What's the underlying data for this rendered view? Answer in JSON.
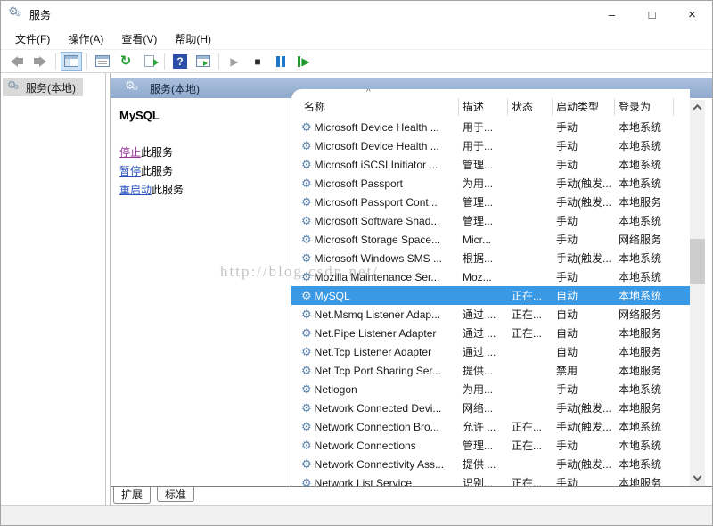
{
  "window": {
    "title": "服务",
    "controls": {
      "minimize": "–",
      "maximize": "□",
      "close": "×"
    }
  },
  "menu": {
    "items": [
      "文件(F)",
      "操作(A)",
      "查看(V)",
      "帮助(H)"
    ]
  },
  "toolbar": {
    "help_glyph": "?",
    "refresh_glyph": "↻",
    "start_glyph": "▶",
    "stop_glyph": "■",
    "restart_glyph": "▶",
    "icons": [
      "back-icon",
      "forward-icon",
      "show-console-tree-icon",
      "properties-icon",
      "refresh-icon",
      "export-list-icon",
      "help-icon",
      "show-action-pane-icon",
      "start-service-icon",
      "stop-service-icon",
      "pause-service-icon",
      "restart-service-icon"
    ]
  },
  "tree": {
    "root_label": "服务(本地)"
  },
  "main": {
    "header_label": "服务(本地)",
    "detail": {
      "service_name": "MySQL",
      "links": [
        {
          "action": "停止",
          "suffix": "此服务",
          "visited": true
        },
        {
          "action": "暂停",
          "suffix": "此服务"
        },
        {
          "action": "重启动",
          "suffix": "此服务"
        }
      ]
    },
    "list": {
      "sort_indicator": "^",
      "columns": [
        "名称",
        "描述",
        "状态",
        "启动类型",
        "登录为"
      ],
      "rows": [
        {
          "name": "Microsoft Device Health ...",
          "desc": "用于...",
          "status": "",
          "startup": "手动",
          "logon": "本地系统"
        },
        {
          "name": "Microsoft Device Health ...",
          "desc": "用于...",
          "status": "",
          "startup": "手动",
          "logon": "本地系统"
        },
        {
          "name": "Microsoft iSCSI Initiator ...",
          "desc": "管理...",
          "status": "",
          "startup": "手动",
          "logon": "本地系统"
        },
        {
          "name": "Microsoft Passport",
          "desc": "为用...",
          "status": "",
          "startup": "手动(触发...",
          "logon": "本地系统"
        },
        {
          "name": "Microsoft Passport Cont...",
          "desc": "管理...",
          "status": "",
          "startup": "手动(触发...",
          "logon": "本地服务"
        },
        {
          "name": "Microsoft Software Shad...",
          "desc": "管理...",
          "status": "",
          "startup": "手动",
          "logon": "本地系统"
        },
        {
          "name": "Microsoft Storage Space...",
          "desc": "Micr...",
          "status": "",
          "startup": "手动",
          "logon": "网络服务"
        },
        {
          "name": "Microsoft Windows SMS ...",
          "desc": "根据...",
          "status": "",
          "startup": "手动(触发...",
          "logon": "本地系统"
        },
        {
          "name": "Mozilla Maintenance Ser...",
          "desc": "Moz...",
          "status": "",
          "startup": "手动",
          "logon": "本地系统"
        },
        {
          "name": "MySQL",
          "desc": "",
          "status": "正在...",
          "startup": "自动",
          "logon": "本地系统",
          "selected": true
        },
        {
          "name": "Net.Msmq Listener Adap...",
          "desc": "通过 ...",
          "status": "正在...",
          "startup": "自动",
          "logon": "网络服务"
        },
        {
          "name": "Net.Pipe Listener Adapter",
          "desc": "通过 ...",
          "status": "正在...",
          "startup": "自动",
          "logon": "本地服务"
        },
        {
          "name": "Net.Tcp Listener Adapter",
          "desc": "通过 ...",
          "status": "",
          "startup": "自动",
          "logon": "本地服务"
        },
        {
          "name": "Net.Tcp Port Sharing Ser...",
          "desc": "提供...",
          "status": "",
          "startup": "禁用",
          "logon": "本地服务"
        },
        {
          "name": "Netlogon",
          "desc": "为用...",
          "status": "",
          "startup": "手动",
          "logon": "本地系统"
        },
        {
          "name": "Network Connected Devi...",
          "desc": "网络...",
          "status": "",
          "startup": "手动(触发...",
          "logon": "本地服务"
        },
        {
          "name": "Network Connection Bro...",
          "desc": "允许 ...",
          "status": "正在...",
          "startup": "手动(触发...",
          "logon": "本地系统"
        },
        {
          "name": "Network Connections",
          "desc": "管理...",
          "status": "正在...",
          "startup": "手动",
          "logon": "本地系统"
        },
        {
          "name": "Network Connectivity Ass...",
          "desc": "提供 ...",
          "status": "",
          "startup": "手动(触发...",
          "logon": "本地系统"
        },
        {
          "name": "Network List Service",
          "desc": "识别...",
          "status": "正在...",
          "startup": "手动",
          "logon": "本地服务"
        }
      ]
    }
  },
  "tabs": [
    {
      "label": "扩展",
      "active": true
    },
    {
      "label": "标准"
    }
  ],
  "watermark": {
    "text": "http://blog.csdn.net/"
  },
  "colors": {
    "selection_blue": "#3a99e5",
    "header_band": "#9db4d3",
    "link_blue": "#2a52be",
    "link_visited": "#993399",
    "toolbar_toggle_bg": "#cde3f7"
  }
}
